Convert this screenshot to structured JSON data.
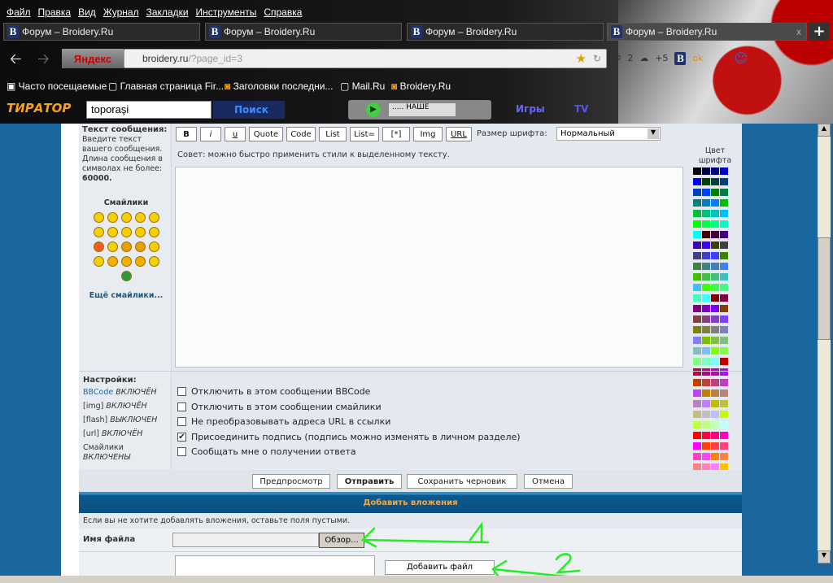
{
  "menu": [
    "Файл",
    "Правка",
    "Вид",
    "Журнал",
    "Закладки",
    "Инструменты",
    "Справка"
  ],
  "tabs": [
    {
      "label": "Форум – Broidery.Ru"
    },
    {
      "label": "Форум – Broidery.Ru"
    },
    {
      "label": "Форум – Broidery.Ru"
    },
    {
      "label": "Форум – Broidery.Ru"
    }
  ],
  "tab_close": "x",
  "new_tab": "+",
  "nav": {
    "yandex": "Яндекс",
    "url_host": "broidery.ru",
    "url_path": "/?page_id=3",
    "mail_count": "2",
    "weather": "+5"
  },
  "bookmarks": [
    "Часто посещаемые",
    "Главная страница Fir...",
    "Заголовки последни...",
    "Mail.Ru",
    "Broidery.Ru"
  ],
  "toolbar": {
    "logo": "ТИРАТОР",
    "search_value": "toporaşi",
    "search_button": "Поиск",
    "station": "..... НАШЕ",
    "games": "Игры",
    "tv": "TV"
  },
  "editor": {
    "label_title": "Текст сообщения:",
    "label_desc": "Введите текст вашего сообщения. Длина сообщения в символах не более:",
    "max_len": "60000.",
    "smilies_title": "Смайлики",
    "more_smilies": "Ещё смайлики...",
    "buttons": [
      "B",
      "i",
      "u",
      "Quote",
      "Code",
      "List",
      "List=",
      "[*]",
      "Img",
      "URL"
    ],
    "font_size_label": "Размер шрифта:",
    "font_size_value": "Нормальный",
    "tip": "Совет: можно быстро применить стили к выделенному тексту.",
    "color_label": "Цвет шрифта",
    "message": ""
  },
  "settings": {
    "title": "Настройки:",
    "status": [
      {
        "name": "BBCode",
        "state": "ВКЛЮЧЁН"
      },
      {
        "name": "[img]",
        "state": "ВКЛЮЧЁН"
      },
      {
        "name": "[flash]",
        "state": "ВЫКЛЮЧЕН"
      },
      {
        "name": "[url]",
        "state": "ВКЛЮЧЁН"
      },
      {
        "name": "Смайлики",
        "state": "ВКЛЮЧЕНЫ"
      }
    ],
    "options": [
      {
        "label": "Отключить в этом сообщении BBCode",
        "checked": false
      },
      {
        "label": "Отключить в этом сообщении смайлики",
        "checked": false
      },
      {
        "label": "Не преобразовывать адреса URL в ссылки",
        "checked": false
      },
      {
        "label": "Присоединить подпись (подпись можно изменять в личном разделе)",
        "checked": true
      },
      {
        "label": "Сообщать мне о получении ответа",
        "checked": false
      }
    ]
  },
  "actions": {
    "preview": "Предпросмотр",
    "submit": "Отправить",
    "save_draft": "Сохранить черновик",
    "cancel": "Отмена"
  },
  "attachments": {
    "header": "Добавить вложения",
    "info": "Если вы не хотите добавлять вложения, оставьте поля пустыми.",
    "filename_label": "Имя файла",
    "filename_value": "",
    "browse": "Обзор...",
    "add_file": "Добавить файл"
  },
  "annotations": {
    "arrow_color": "#22ee22",
    "marks": [
      "1",
      "2"
    ]
  },
  "colors": {
    "page_bg": "#1a67a0",
    "header_bar": "#0d5a8e",
    "header_text": "#f0a850",
    "link": "#1a5a8a"
  }
}
